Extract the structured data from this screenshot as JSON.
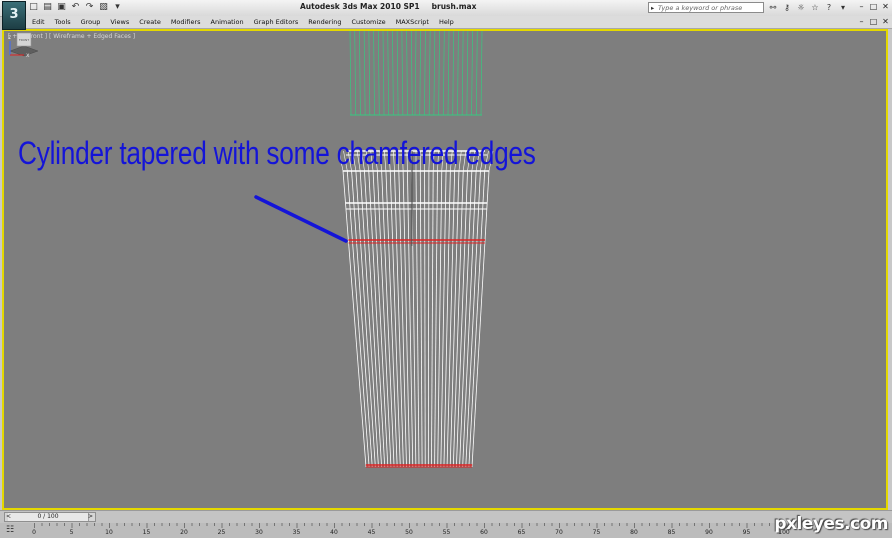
{
  "window": {
    "title": "Autodesk 3ds Max  2010 SP1",
    "file": "brush.max"
  },
  "app_logo": "3",
  "quick_access": [
    {
      "icon": "new-file-icon",
      "glyph": "□"
    },
    {
      "icon": "open-folder-icon",
      "glyph": "▤"
    },
    {
      "icon": "save-icon",
      "glyph": "▣"
    },
    {
      "icon": "undo-icon",
      "glyph": "↶"
    },
    {
      "icon": "redo-icon",
      "glyph": "↷"
    },
    {
      "icon": "project-folder-icon",
      "glyph": "▧"
    },
    {
      "icon": "dropdown-icon",
      "glyph": "▾"
    }
  ],
  "search": {
    "placeholder": "Type a keyword or phrase"
  },
  "infocenter": [
    {
      "icon": "binoculars-icon",
      "glyph": "⚯"
    },
    {
      "icon": "key-icon",
      "glyph": "⚷"
    },
    {
      "icon": "communication-icon",
      "glyph": "☼"
    },
    {
      "icon": "favorites-star-icon",
      "glyph": "☆"
    },
    {
      "icon": "help-icon",
      "glyph": "?"
    },
    {
      "icon": "help-dropdown-icon",
      "glyph": "▾"
    }
  ],
  "menu": [
    "Edit",
    "Tools",
    "Group",
    "Views",
    "Create",
    "Modifiers",
    "Animation",
    "Graph Editors",
    "Rendering",
    "Customize",
    "MAXScript",
    "Help"
  ],
  "viewport": {
    "label": "[ + ] [ Front ] [ Wireframe + Edged Faces ]",
    "annotation": "Cylinder tapered with some chamfered edges",
    "colors": {
      "background": "#7e7e7e",
      "border": "#e4d800",
      "selected_wire": "#ffffff",
      "highlight_edges": "#e02020",
      "other_object": "#38c880",
      "annotation": "#1414d8"
    }
  },
  "viewcube": {
    "face_label": "FRONT"
  },
  "axis": {
    "z": "z",
    "x": "x"
  },
  "timeline": {
    "current": "0 / 100",
    "prev": "<",
    "next": ">"
  },
  "trackbar": {
    "icon": "trackbar-icon",
    "ticks": [
      "0",
      "5",
      "10",
      "15",
      "20",
      "25",
      "30",
      "35",
      "40",
      "45",
      "50",
      "55",
      "60",
      "65",
      "70",
      "75",
      "80",
      "85",
      "90",
      "95",
      "100"
    ]
  },
  "watermark": "pxleyes.com"
}
